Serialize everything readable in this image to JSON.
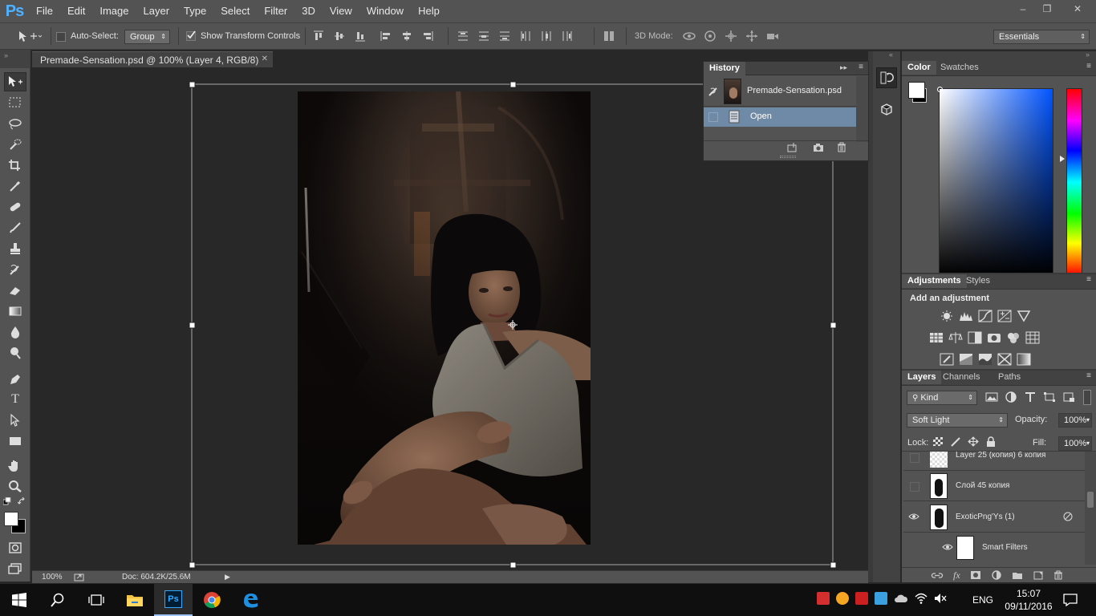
{
  "app": {
    "logo": "Ps",
    "menu": [
      "File",
      "Edit",
      "Image",
      "Layer",
      "Type",
      "Select",
      "Filter",
      "3D",
      "View",
      "Window",
      "Help"
    ],
    "window_controls": {
      "minimize": "–",
      "restore": "❐",
      "close": "✕"
    }
  },
  "options_bar": {
    "auto_select_label": "Auto-Select:",
    "auto_select_checked": false,
    "auto_select_value": "Group",
    "show_transform_label": "Show Transform Controls",
    "show_transform_checked": true,
    "mode_3d_label": "3D Mode:",
    "workspace": "Essentials"
  },
  "document": {
    "tab_title": "Premade-Sensation.psd @ 100% (Layer 4, RGB/8) *",
    "close_glyph": "✕",
    "zoom": "100%",
    "doc_info": "Doc: 604.2K/25.6M"
  },
  "history": {
    "title": "History",
    "snapshot_name": "Premade-Sensation.psd",
    "states": [
      "Open"
    ]
  },
  "color_panel": {
    "tabs": [
      "Color",
      "Swatches"
    ],
    "foreground": "#ffffff",
    "background": "#000000"
  },
  "adjustments": {
    "tabs": [
      "Adjustments",
      "Styles"
    ],
    "heading": "Add an adjustment"
  },
  "layers": {
    "tabs": [
      "Layers",
      "Channels",
      "Paths"
    ],
    "filter_kind": "Kind",
    "blend_mode": "Soft Light",
    "opacity_label": "Opacity:",
    "opacity": "100%",
    "lock_label": "Lock:",
    "fill_label": "Fill:",
    "fill": "100%",
    "items": [
      {
        "name": "Layer 25 (копия) 6 копия",
        "visible": false
      },
      {
        "name": "Слой 45 копия",
        "visible": false
      },
      {
        "name": "ExoticPng'Ys (1)",
        "visible": true
      },
      {
        "name": "Smart Filters",
        "visible": true
      }
    ]
  },
  "taskbar": {
    "language": "ENG",
    "time": "15:07",
    "date": "09/11/2016"
  },
  "colors": {
    "ps_blue": "#4fb1ff",
    "panel": "#535353",
    "panel_dark": "#424242",
    "canvas_bg": "#282828",
    "selection": "#6f8aa6"
  }
}
